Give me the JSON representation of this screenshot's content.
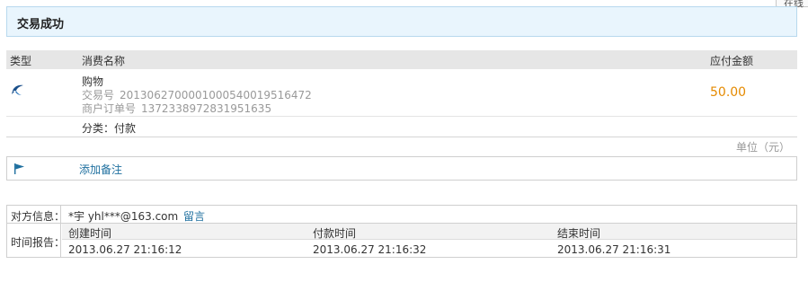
{
  "corner_tab": {
    "label": "在线"
  },
  "banner": {
    "title": "交易成功"
  },
  "table": {
    "headers": {
      "type": "类型",
      "name": "消费名称",
      "amount": "应付金额"
    },
    "order": {
      "type_icon": "swallow-logo-icon",
      "item_name": "购物",
      "trade_no_label": "交易号",
      "trade_no": "2013062700001000540019516472",
      "merchant_no_label": "商户订单号",
      "merchant_no": "1372338972831951635",
      "amount": "50.00"
    },
    "category": "分类：付款",
    "unit": "单位（元）"
  },
  "note": {
    "flag_icon": "flag-icon",
    "add_note_label": "添加备注"
  },
  "info": {
    "counterparty_label": "对方信息：",
    "counterparty": "*宇  yhl***@163.com",
    "leave_message": "留言",
    "time_report_label": "时间报告：",
    "time_columns": [
      {
        "label": "创建时间",
        "value": "2013.06.27 21:16:12"
      },
      {
        "label": "付款时间",
        "value": "2013.06.27 21:16:32"
      },
      {
        "label": "结束时间",
        "value": "2013.06.27 21:16:31"
      }
    ]
  },
  "colors": {
    "accent_amount": "#e58a00",
    "link": "#1e6f9f",
    "banner_bg": "#e9f5fd"
  }
}
